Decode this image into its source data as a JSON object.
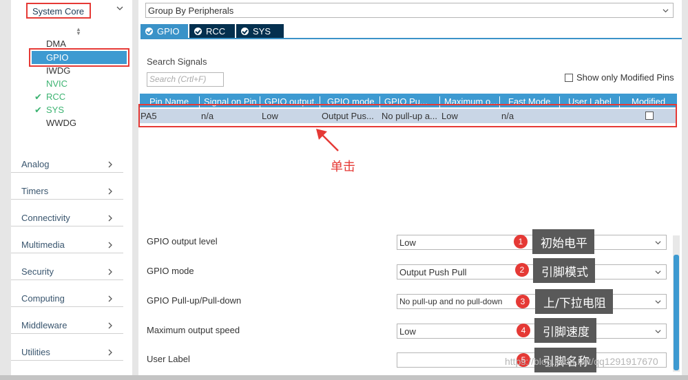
{
  "sidebar": {
    "system_core": "System Core",
    "sub_items": [
      {
        "label": "DMA",
        "checked": false,
        "color": "#333333"
      },
      {
        "label": "GPIO",
        "checked": false,
        "color": "#ffffff"
      },
      {
        "label": "IWDG",
        "checked": false,
        "color": "#333333"
      },
      {
        "label": "NVIC",
        "checked": false,
        "color": "#3cb371"
      },
      {
        "label": "RCC",
        "checked": true,
        "color": "#3cb371"
      },
      {
        "label": "SYS",
        "checked": true,
        "color": "#3cb371"
      },
      {
        "label": "WWDG",
        "checked": false,
        "color": "#333333"
      }
    ],
    "categories": [
      "Analog",
      "Timers",
      "Connectivity",
      "Multimedia",
      "Security",
      "Computing",
      "Middleware",
      "Utilities"
    ]
  },
  "main": {
    "group_select": "Group By Peripherals",
    "tabs": [
      {
        "label": "GPIO",
        "active": true
      },
      {
        "label": "RCC",
        "active": false
      },
      {
        "label": "SYS",
        "active": false
      }
    ],
    "search_label": "Search Signals",
    "search_placeholder": "Search (Crtl+F)",
    "modified_pins_label": "Show only Modified Pins",
    "table": {
      "columns": [
        "Pin Name",
        "Signal on Pin",
        "GPIO output...",
        "GPIO mode",
        "GPIO Pu...",
        "Maximum o...",
        "Fast Mode",
        "User Label",
        "Modified"
      ],
      "rows": [
        [
          "PA5",
          "n/a",
          "Low",
          "Output Pus...",
          "No pull-up a...",
          "Low",
          "n/a",
          "",
          ""
        ]
      ]
    },
    "annotation_click": "单击",
    "form": [
      {
        "label": "GPIO output level",
        "value": "Low"
      },
      {
        "label": "GPIO mode",
        "value": "Output Push Pull"
      },
      {
        "label": "GPIO Pull-up/Pull-down",
        "value": "No pull-up and no pull-down"
      },
      {
        "label": "Maximum output speed",
        "value": "Low"
      },
      {
        "label": "User Label",
        "value": ""
      }
    ],
    "callouts": [
      {
        "num": "1",
        "text": "初始电平"
      },
      {
        "num": "2",
        "text": "引脚模式"
      },
      {
        "num": "3",
        "text": "上/下拉电阻"
      },
      {
        "num": "4",
        "text": "引脚速度"
      },
      {
        "num": "5",
        "text": "引脚名称"
      }
    ],
    "watermark": "https://blog.csdn.net/qq1291917670"
  },
  "colors": {
    "accent": "#3d9ad1",
    "tab_dark": "#04304f",
    "highlight_red": "#e53935",
    "ok_green": "#3cb371"
  }
}
